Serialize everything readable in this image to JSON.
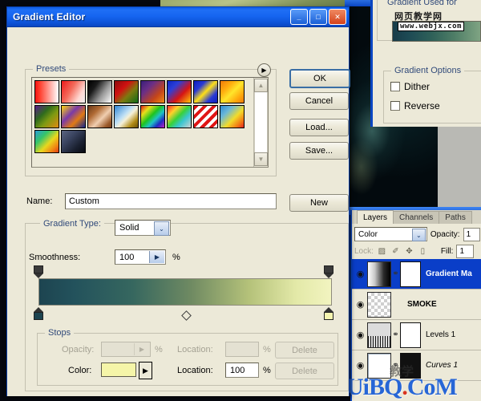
{
  "dialog": {
    "title": "Gradient Editor",
    "caption_buttons": [
      {
        "name": "minimize",
        "glyph": "_"
      },
      {
        "name": "maximize",
        "glyph": "□"
      },
      {
        "name": "close",
        "glyph": "✕"
      }
    ]
  },
  "presets": {
    "legend": "Presets",
    "arrow_glyph": "▶",
    "scroll_up_glyph": "▲",
    "scroll_down_glyph": "▼",
    "swatches": [
      {
        "name": "foreground-to-transparent-red",
        "css": "linear-gradient(90deg,#f21414 0%,#ff3b2a 18%,#ffffff 100%)"
      },
      {
        "name": "red-to-transparent-checker",
        "css": "linear-gradient(120deg,#ef1b1b 0%,#f46a5a 40%,#ffd8d2 75%,#efefef 100%)"
      },
      {
        "name": "black-to-white",
        "css": "linear-gradient(125deg,#000000 0%,#1a1a1a 28%,#9a9a9a 62%,#ffffff 100%)"
      },
      {
        "name": "red-green",
        "css": "linear-gradient(135deg,#8c0d0d 0%,#d01111 35%,#7d7a10 62%,#0d6b17 100%)"
      },
      {
        "name": "violet-orange",
        "css": "linear-gradient(135deg,#3a1f7a 0%,#6b2f86 32%,#c4451a 68%,#f08c14 100%)"
      },
      {
        "name": "blue-red-yellow",
        "css": "linear-gradient(135deg,#1026c4 0%,#2c3fd8 28%,#d61414 62%,#ffc80a 100%)"
      },
      {
        "name": "blue-yellow-blue",
        "css": "linear-gradient(135deg,#0d1fbf 0%,#2a3ad4 26%,#ffe017 50%,#2a3ad4 76%,#0d1fbf 100%)"
      },
      {
        "name": "orange-yellow-orange",
        "css": "linear-gradient(135deg,#f07a0a 0%,#ffae10 30%,#ffe52b 52%,#ffa80d 78%,#ef7a0a 100%)"
      },
      {
        "name": "violet-green-orange",
        "css": "linear-gradient(135deg,#5a1d8a 0%,#2f6b1d 35%,#7d9a12 60%,#e08a12 100%)"
      },
      {
        "name": "yellow-violet-orange-blue",
        "css": "linear-gradient(135deg,#ffd90d 0%,#7a3aa8 38%,#e07a14 66%,#11268f 100%)"
      },
      {
        "name": "copper",
        "css": "linear-gradient(135deg,#6b3a18 0%,#b06a34 30%,#f0ceb0 58%,#9a5a2a 85%,#7a3f1c 100%)"
      },
      {
        "name": "chrome",
        "css": "linear-gradient(135deg,#2f86d4 0%,#bfe0f5 42%,#f5f0d8 55%,#b08a14 80%,#6b5209 100%)"
      },
      {
        "name": "spectrum",
        "css": "linear-gradient(135deg,#e01b1b 0%,#e8e01b 22%,#1ec41e 45%,#1ec4c4 62%,#1e2cc4 80%,#c41ec4 100%)"
      },
      {
        "name": "transparent-rainbow",
        "css": "linear-gradient(135deg,#ff2a2a 0%,#ffd22a 25%,#39d139 48%,#39c6d1 68%,#d1d1d1 100%)"
      },
      {
        "name": "red-stripes",
        "css": "repeating-linear-gradient(135deg,#e01515 0 4px,#ffffff 4px 8px)"
      },
      {
        "name": "blue-yellow-red",
        "css": "linear-gradient(135deg,#2b8ad6 0%,#6cb8d8 28%,#f2dc2a 58%,#f27b14 82%,#e02222 100%)"
      },
      {
        "name": "blue-orange-rainbow",
        "css": "linear-gradient(135deg,#2b9ad6 0%,#35c46a 30%,#e8d81e 58%,#f08a14 80%,#e03a14 100%)"
      },
      {
        "name": "dark-blue-black",
        "css": "linear-gradient(135deg,#5a6480 0%,#3a4460 35%,#1a2030 70%,#070a10 100%)"
      }
    ]
  },
  "buttons": {
    "ok": "OK",
    "cancel": "Cancel",
    "load": "Load...",
    "save": "Save...",
    "new": "New"
  },
  "name_field": {
    "label": "Name:",
    "value": "Custom"
  },
  "gradient_type": {
    "label": "Gradient Type:",
    "value": "Solid",
    "arrow_glyph": "⌄"
  },
  "smoothness": {
    "label": "Smoothness:",
    "value": "100",
    "unit": "%",
    "arrow_glyph": "▶"
  },
  "gradient_preview": {
    "css": "linear-gradient(90deg,#1d4450 0%,#23525c 12%,#36675f 32%,#6f8a62 52%,#b5c27a 72%,#e3e9a8 88%,#f2f4c0 100%)",
    "opacity_stops": [
      {
        "name": "opacity-stop-left",
        "position_pct": 0
      },
      {
        "name": "opacity-stop-right",
        "position_pct": 100
      }
    ],
    "color_stops": [
      {
        "name": "color-stop-left",
        "position_pct": 0,
        "color": "#1d4450"
      },
      {
        "name": "color-stop-right",
        "position_pct": 100,
        "color": "#f5f5b0"
      }
    ],
    "midpoint_pct": 50
  },
  "stops": {
    "legend": "Stops",
    "opacity_label": "Opacity:",
    "opacity_value": "",
    "opacity_unit": "%",
    "location_label_top": "Location:",
    "location_value_top": "",
    "location_unit_top": "%",
    "delete_top": "Delete",
    "color_label": "Color:",
    "color_value": "#f5f5a8",
    "color_arrow_glyph": "▶",
    "location_label_bottom": "Location:",
    "location_value_bottom": "100",
    "location_unit_bottom": "%",
    "delete_bottom": "Delete"
  },
  "gradient_used": {
    "legend": "Gradient Used for",
    "cn_watermark": "网页教学网",
    "url_watermark": "www.webjx.com",
    "preview_css": "linear-gradient(90deg,#173b48 0%,#1d4a54 18%,#2f6159 45%,#4e7d66 70%,#7fa483 100%)"
  },
  "gradient_options": {
    "legend": "Gradient Options",
    "items": [
      {
        "name": "dither",
        "label": "Dither",
        "checked": false
      },
      {
        "name": "reverse",
        "label": "Reverse",
        "checked": false
      }
    ]
  },
  "layers_panel": {
    "tabs": [
      {
        "name": "layers",
        "label": "Layers",
        "active": true
      },
      {
        "name": "channels",
        "label": "Channels",
        "active": false
      },
      {
        "name": "paths",
        "label": "Paths",
        "active": false
      }
    ],
    "blend_mode": "Color",
    "blend_arrow_glyph": "⌄",
    "opacity_label": "Opacity:",
    "opacity_value": "1",
    "lock_label": "Lock:",
    "lock_icons": [
      {
        "name": "lock-transparency-icon",
        "glyph": "▨"
      },
      {
        "name": "lock-image-icon",
        "glyph": "✐"
      },
      {
        "name": "lock-position-icon",
        "glyph": "✥"
      },
      {
        "name": "lock-all-icon",
        "glyph": "▯"
      }
    ],
    "fill_label": "Fill:",
    "fill_value": "1",
    "eye_glyph": "◉",
    "link_glyph": "⚭",
    "rows": [
      {
        "name": "gradient-map-layer",
        "label": "Gradient Ma",
        "selected": true,
        "has_mask": true,
        "thumb": "gradient-ramp"
      },
      {
        "name": "smoke-layer",
        "label": "SMOKE",
        "selected": false,
        "has_mask": false,
        "thumb": "smoke"
      },
      {
        "name": "levels-layer",
        "label": "Levels 1",
        "selected": false,
        "has_mask": true,
        "thumb": "histogram"
      },
      {
        "name": "curves-layer",
        "label": "Curves 1",
        "selected": false,
        "has_mask": true,
        "thumb": "curve"
      }
    ]
  },
  "site_watermark": {
    "prefix": "UiBQ",
    "dot": ".",
    "suffix": "CoM",
    "cn": "教学"
  }
}
